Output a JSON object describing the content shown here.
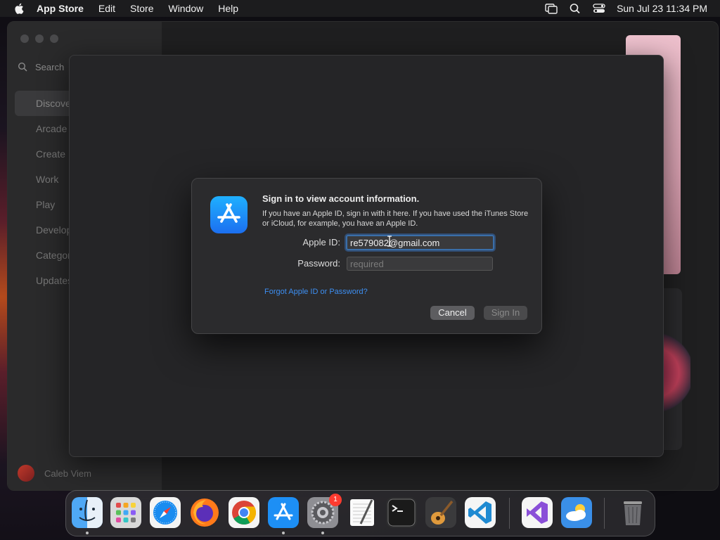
{
  "menubar": {
    "app_name": "App Store",
    "items": [
      "Edit",
      "Store",
      "Window",
      "Help"
    ],
    "clock": "Sun Jul 23  11:34 PM"
  },
  "sidebar": {
    "search_placeholder": "Search",
    "items": [
      "Discover",
      "Arcade",
      "Create",
      "Work",
      "Play",
      "Develop",
      "Categories",
      "Updates"
    ],
    "user": "Caleb Viem"
  },
  "dialog": {
    "title": "Sign in to view account information.",
    "message": "If you have an Apple ID, sign in with it here. If you have used the iTunes Store or iCloud, for example, you have an Apple ID.",
    "apple_id_label": "Apple ID:",
    "apple_id_value": "re579082@gmail.com",
    "password_label": "Password:",
    "password_placeholder": "required",
    "forgot_link": "Forgot Apple ID or Password?",
    "cancel_label": "Cancel",
    "signin_label": "Sign In"
  },
  "dock": {
    "apps": [
      "Finder",
      "Launchpad",
      "Safari",
      "Firefox",
      "Chrome",
      "App Store",
      "System Settings",
      "TextEdit",
      "Terminal",
      "GarageBand",
      "Visual Studio Code",
      "Visual Studio",
      "Weather",
      "Trash"
    ],
    "settings_badge": "1"
  }
}
